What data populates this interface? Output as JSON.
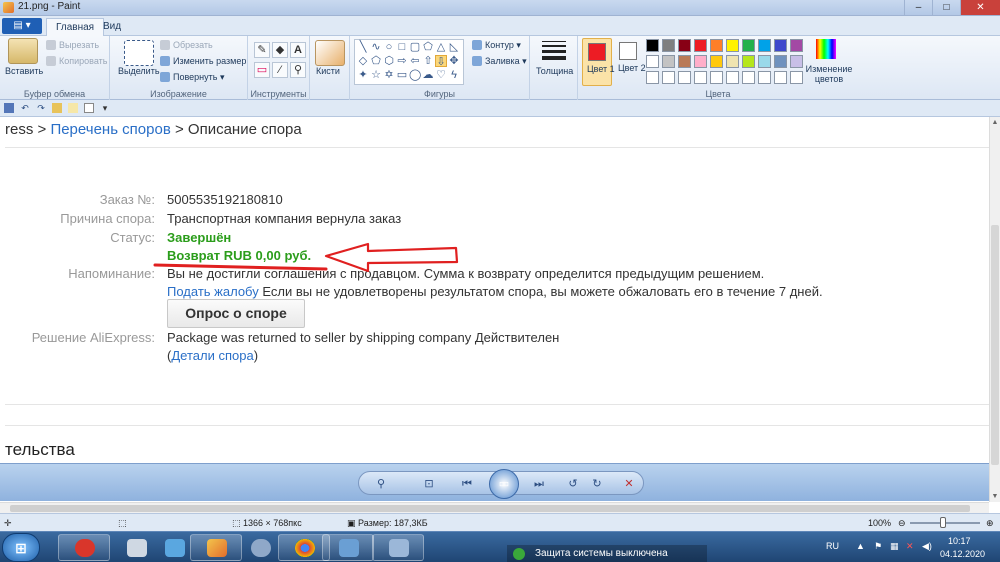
{
  "window": {
    "title": "21.png - Paint",
    "controls": [
      "–",
      "□",
      "✕"
    ]
  },
  "ribbon": {
    "file_label": "▤ ▾",
    "tabs": [
      "Главная",
      "Вид"
    ],
    "clipboard": {
      "paste": "Вставить",
      "cut": "Вырезать",
      "copy": "Копировать",
      "group": "Буфер обмена"
    },
    "image": {
      "select": "Выделить",
      "crop": "Обрезать",
      "resize": "Изменить размер",
      "rotate": "Повернуть ▾",
      "group": "Изображение"
    },
    "tools": {
      "group": "Инструменты",
      "brushes": "Кисти"
    },
    "shapes": {
      "outline": "Контур ▾",
      "fill": "Заливка ▾",
      "group": "Фигуры"
    },
    "size": {
      "label": "Толщина"
    },
    "colors": {
      "color1": "Цвет 1",
      "color2": "Цвет 2",
      "edit": "Изменение цветов",
      "group": "Цвета",
      "palette_row1": [
        "#000000",
        "#7f7f7f",
        "#880015",
        "#ed1c24",
        "#ff7f27",
        "#fff200",
        "#22b14c",
        "#00a2e8",
        "#3f48cc",
        "#a349a4"
      ],
      "palette_row2": [
        "#ffffff",
        "#c3c3c3",
        "#b97a57",
        "#ffaec9",
        "#ffc90e",
        "#efe4b0",
        "#b5e61d",
        "#99d9ea",
        "#7092be",
        "#c8bfe7"
      ]
    }
  },
  "page": {
    "crumb_prefix": "ress > ",
    "crumb_link": "Перечень споров",
    "crumb_sep": " > ",
    "crumb_current": "Описание спора",
    "order_label": "Заказ №:",
    "order_value": "5005535192180810",
    "reason_label": "Причина спора:",
    "reason_value": "Транспортная компания вернула заказ",
    "status_label": "Статус:",
    "status_value": "Завершён",
    "refund_value": "Возврат RUB 0,00 руб.",
    "reminder_label": "Напоминание:",
    "reminder_text": "Вы не достигли соглашения с продавцом. Сумма к возврату определится предыдущим решением.",
    "complaint_link": "Подать жалобу",
    "complaint_text": " Если вы не удовлетворены результатом спора, вы можете обжаловать его в течение 7 дней.",
    "survey_button": "Опрос о споре",
    "decision_label": "Решение AliExpress:",
    "decision_value": "Package was returned to seller by shipping company  Действителен",
    "details_open": "(",
    "details_link": "Детали спора",
    "details_close": ")",
    "section_heading": "тельства"
  },
  "annotation": {
    "arrow_color": "#e02020"
  },
  "status_bar": {
    "dimensions": "1366 × 768пкс",
    "size": "Размер: 187,3КБ",
    "zoom": "100%"
  },
  "taskbar": {
    "lang": "RU",
    "notification": "Защита системы выключена",
    "time": "10:17",
    "date": "04.12.2020"
  }
}
